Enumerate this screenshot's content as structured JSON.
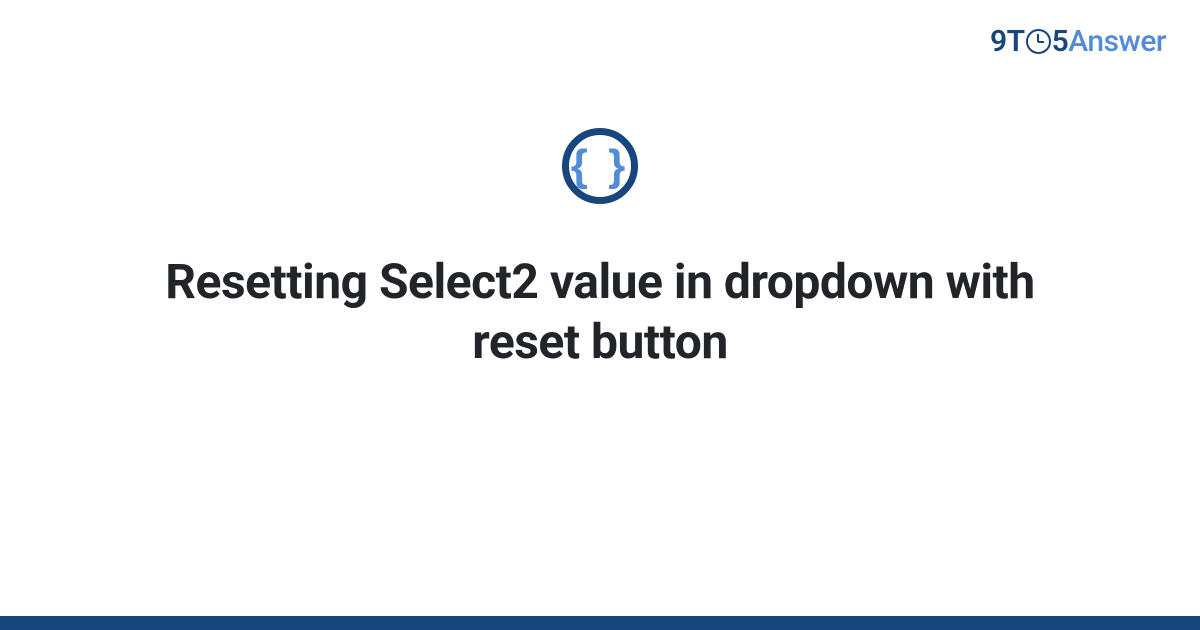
{
  "header": {
    "logo": {
      "prefix": "9T",
      "suffix": "5",
      "word": "Answer"
    }
  },
  "main": {
    "icon_name": "braces-icon",
    "icon_glyph": "{ }",
    "title": "Resetting Select2 value in dropdown with reset button"
  },
  "colors": {
    "primary": "#17457c",
    "accent": "#528cd6",
    "text": "#212529"
  }
}
